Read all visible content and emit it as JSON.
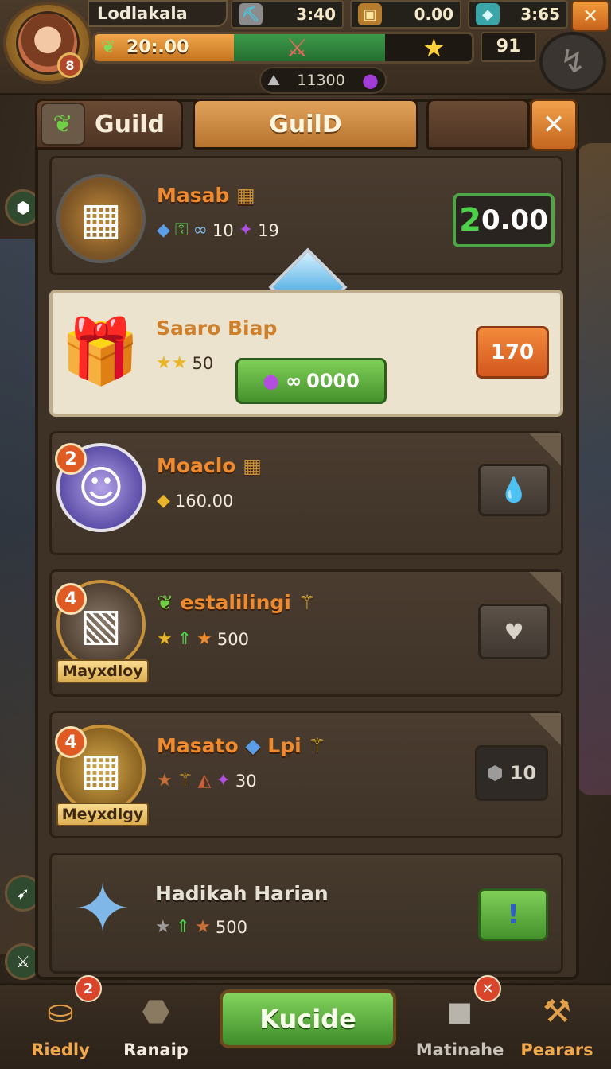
{
  "hud": {
    "player_name": "Lodlakala",
    "avatar_level": "8",
    "resources": [
      {
        "icon": "ore-icon",
        "value": "3:40"
      },
      {
        "icon": "chest-icon",
        "value": "0.00"
      },
      {
        "icon": "gem-cube-icon",
        "value": "3:65"
      }
    ],
    "xp_text": "20:.00",
    "xp_fill_orange": 0.37,
    "xp_fill_green": 0.4,
    "right_count": "91",
    "mini_resource": "11300",
    "close_label": "✕"
  },
  "tabs": [
    {
      "label": "Guild",
      "icon": "leaf-icon",
      "active": false
    },
    {
      "label": "GuilD",
      "active": true
    },
    {
      "label": "",
      "active": false
    }
  ],
  "panel_close": "✕",
  "rows": [
    {
      "title": "Masab",
      "title_icon": "chest-small-icon",
      "stats": [
        "10",
        "19"
      ],
      "button_prefix": "2",
      "button_label": "0.00",
      "button_style": "green-dark"
    },
    {
      "title": "Saaro Biap",
      "stat": "50",
      "green_button_label": "0000",
      "button_label": "170",
      "button_style": "orange",
      "highlighted": true
    },
    {
      "title": "Moaclo",
      "badge": "2",
      "stat": "160.00",
      "button_icon": "potion-icon",
      "button_style": "grey"
    },
    {
      "title": "estalilingi",
      "badge": "4",
      "ribbon": "Mayxdloy",
      "stat": "500",
      "button_icon": "heart-icon",
      "button_style": "grey"
    },
    {
      "title": "Masato",
      "title_suffix": "Lpi",
      "badge": "4",
      "ribbon": "Meyxdlgy",
      "stat": "30",
      "button_label": "10",
      "button_icon": "stone-icon",
      "button_style": "grey"
    },
    {
      "title": "Hadikah Harian",
      "stat": "500",
      "button_label": "!",
      "button_style": "green"
    }
  ],
  "nav": {
    "items": [
      {
        "label": "Riedly",
        "icon": "basket-icon",
        "badge": "2",
        "color": "#f0a84a"
      },
      {
        "label": "Ranaip",
        "icon": "rocks-icon",
        "color": "#f3ecde"
      },
      {
        "label": "Matinahe",
        "icon": "cube-icon",
        "badge": "✕",
        "color": "#c9c4bb"
      },
      {
        "label": "Pearars",
        "icon": "hammer-icon",
        "color": "#f0a84a"
      }
    ],
    "main_button": "Kucide"
  },
  "colors": {
    "accent_orange": "#f08a2e",
    "accent_green": "#4fa646",
    "panel_bg": "#3e3227"
  }
}
